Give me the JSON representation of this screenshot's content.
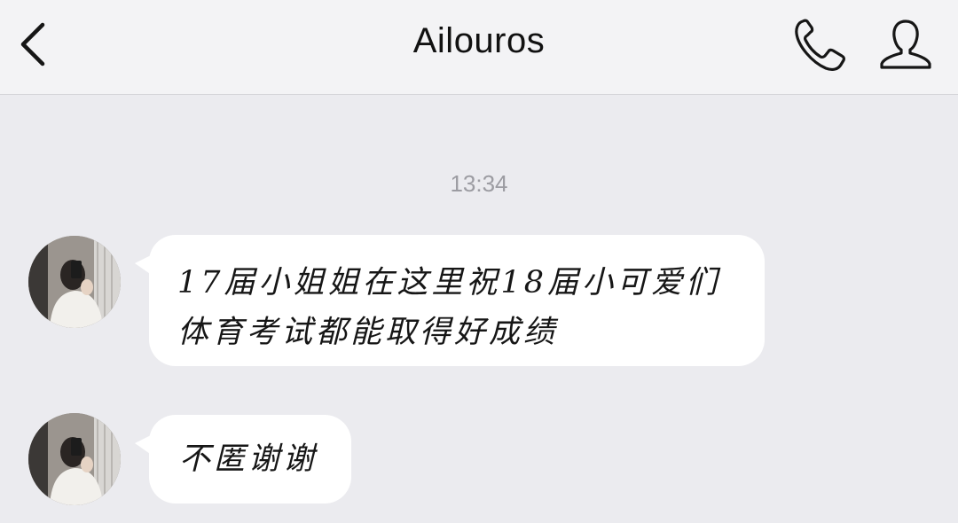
{
  "header": {
    "title": "Ailouros",
    "back_icon": "chevron-left-icon",
    "call_icon": "phone-icon",
    "profile_icon": "person-icon"
  },
  "chat": {
    "timestamp": "13:34",
    "messages": [
      {
        "sender": "incoming",
        "text": "17届小姐姐在这里祝18届小可爱们\n体育考试都能取得好成绩"
      },
      {
        "sender": "incoming",
        "text": "不匿谢谢"
      }
    ]
  },
  "colors": {
    "background": "#ebebef",
    "navbar": "#f3f3f5",
    "bubble": "#ffffff",
    "timestamp": "#9c9ca2",
    "text": "#161616"
  }
}
